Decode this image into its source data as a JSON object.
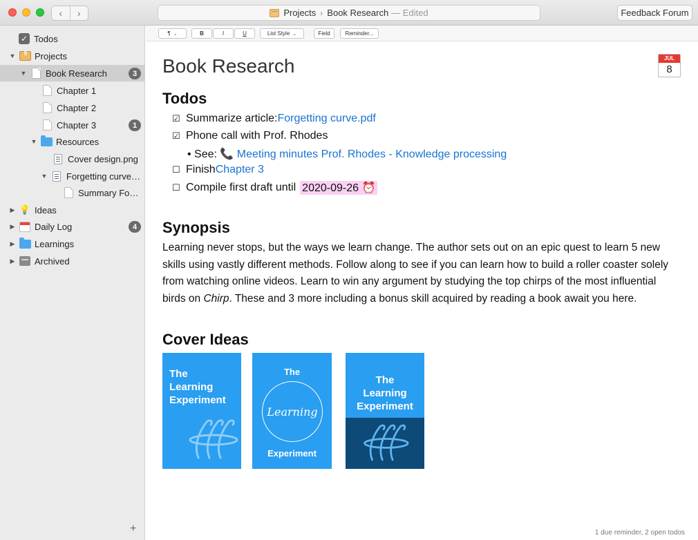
{
  "window": {
    "breadcrumb": [
      "Projects",
      "Book Research"
    ],
    "edited_label": "— Edited",
    "feedback_button": "Feedback Forum"
  },
  "sidebar": {
    "items": [
      {
        "label": "Todos",
        "icon": "checkbox-icon"
      },
      {
        "label": "Projects",
        "icon": "box-icon"
      },
      {
        "label": "Book Research",
        "icon": "document-icon",
        "badge": "3",
        "selected": true
      },
      {
        "label": "Chapter 1",
        "icon": "document-icon"
      },
      {
        "label": "Chapter 2",
        "icon": "document-icon"
      },
      {
        "label": "Chapter 3",
        "icon": "document-icon",
        "badge": "1"
      },
      {
        "label": "Resources",
        "icon": "folder-icon"
      },
      {
        "label": "Cover design.png",
        "icon": "file-icon"
      },
      {
        "label": "Forgetting curve.pdf",
        "icon": "file-icon"
      },
      {
        "label": "Summary Forgetting curve",
        "icon": "document-icon"
      },
      {
        "label": "Ideas",
        "icon": "lightbulb-icon"
      },
      {
        "label": "Daily Log",
        "icon": "calendar-icon",
        "badge": "4"
      },
      {
        "label": "Learnings",
        "icon": "folder-icon"
      },
      {
        "label": "Archived",
        "icon": "archive-icon"
      }
    ],
    "add_label": "+"
  },
  "toolbar": {
    "paragraph": "¶",
    "bold": "B",
    "italic": "I",
    "underline": "U",
    "list_style": "List Style",
    "field": "Field",
    "reminder": "Reminder..."
  },
  "document": {
    "title": "Book Research",
    "calendar": {
      "month": "JUL",
      "day": "8"
    },
    "todos_heading": "Todos",
    "todos": [
      {
        "checked": true,
        "text": "Summarize article: ",
        "link": "Forgetting curve.pdf"
      },
      {
        "checked": true,
        "text": "Phone call with Prof. Rhodes"
      },
      {
        "checked": false,
        "text": "Finish ",
        "link": "Chapter 3"
      },
      {
        "checked": false,
        "text": "Compile first draft until",
        "date": "2020-09-26"
      }
    ],
    "sub_item": {
      "prefix": "See: ",
      "link": "Meeting minutes Prof. Rhodes - Knowledge processing"
    },
    "synopsis_heading": "Synopsis",
    "synopsis_before": "Learning never stops, but the ways we learn change. The author sets out on an epic quest to learn 5 new skills using vastly different methods. Follow along to see if you can learn how to build a roller coaster solely from watching online videos. Learn to win any argument by studying the top chirps of the most influential birds on ",
    "synopsis_italic": "Chirp",
    "synopsis_after": ". These and 3 more including a bonus skill acquired by reading a book await you here.",
    "cover_heading": "Cover Ideas",
    "covers": [
      {
        "lines": [
          "The",
          "Learning",
          "Experiment"
        ]
      },
      {
        "top": "The",
        "circle": "Learning",
        "bottom": "Experiment"
      },
      {
        "lines": [
          "The",
          "Learning",
          "Experiment"
        ]
      }
    ]
  },
  "status_bar": "1 due reminder, 2 open todos",
  "colors": {
    "accent": "#1a73d1",
    "cover_blue": "#2a9ef0",
    "cover_dark": "#0d4a78",
    "highlight": "#f078dc",
    "badge": "#6b6b6b"
  }
}
